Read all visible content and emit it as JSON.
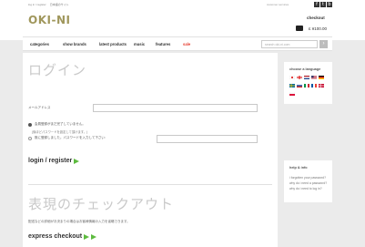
{
  "header": {
    "login_link": "log in / register",
    "language_link": "日本語のサイト",
    "customer_services": "customer services",
    "icons": [
      "facebook-icon",
      "twitter-icon",
      "blog-icon"
    ],
    "icon_glyphs": [
      "f",
      "t",
      "b"
    ],
    "logo_text": "OKI-NI",
    "checkout_label": "checkout",
    "cart_total": "£ ¥100.00"
  },
  "nav": {
    "items": [
      "categories",
      "show brands",
      "latest products",
      "music",
      "features",
      "sale"
    ],
    "search_placeholder": "search oki-ni.com",
    "search_glyph": "›"
  },
  "login": {
    "title": "ログイン",
    "email_label": "メールアドレス",
    "option_new": "会員登録がまだ完了していません。",
    "note": "(後ほどパスワードを設定して頂けます。)",
    "option_existing": "既に登録しました。パスワードを入力して下さい:",
    "login_button": "login / register"
  },
  "express": {
    "title": "表現のチェックアウト",
    "description": "配送などの詳細がお決まりの場合はお客様情報の入力を省略できます。",
    "button": "express checkout"
  },
  "sidebar": {
    "language_title": "choose a language",
    "help_title": "help & info",
    "help_links": [
      "i forgotten your password?",
      "why do i need a password?",
      "why do i need to log in?"
    ]
  },
  "colors": {
    "logo": "#a0975c",
    "sale": "#e63b2e",
    "arrow": "#5dbb3f",
    "background": "#ebebeb"
  }
}
